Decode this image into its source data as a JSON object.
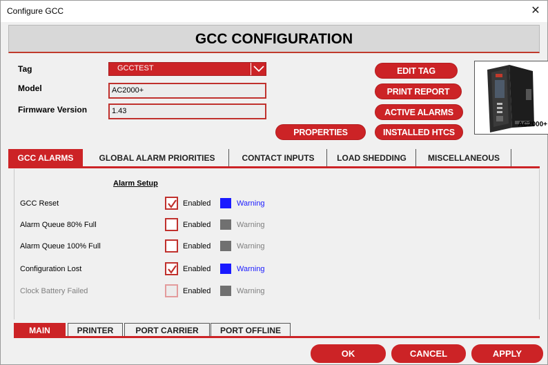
{
  "window": {
    "title": "Configure GCC",
    "close_glyph": "✕"
  },
  "banner": {
    "title": "GCC CONFIGURATION"
  },
  "info": {
    "tag_label": "Tag",
    "tag_value": "GCCTEST",
    "model_label": "Model",
    "model_value": "AC2000+",
    "firmware_label": "Firmware Version",
    "firmware_value": "1.43",
    "device_label": "AC2000+"
  },
  "actions": {
    "edit_tag": "EDIT TAG",
    "print_report": "PRINT REPORT",
    "active_alarms": "ACTIVE ALARMS",
    "installed_htcs": "INSTALLED HTCS",
    "properties": "PROPERTIES"
  },
  "top_tabs": [
    {
      "label": "GCC ALARMS",
      "active": true
    },
    {
      "label": "GLOBAL ALARM PRIORITIES",
      "active": false
    },
    {
      "label": "CONTACT INPUTS",
      "active": false
    },
    {
      "label": "LOAD SHEDDING",
      "active": false
    },
    {
      "label": "MISCELLANEOUS",
      "active": false
    }
  ],
  "alarm_setup": {
    "header": "Alarm Setup",
    "enabled_label": "Enabled",
    "warning_label": "Warning",
    "rows": [
      {
        "name": "GCC Reset",
        "checked": true,
        "disabled": false,
        "severity_color": "#1a1aff"
      },
      {
        "name": "Alarm Queue 80% Full",
        "checked": false,
        "disabled": false,
        "severity_color": "#707070"
      },
      {
        "name": "Alarm Queue 100% Full",
        "checked": false,
        "disabled": false,
        "severity_color": "#707070"
      },
      {
        "name": "Configuration Lost",
        "checked": true,
        "disabled": false,
        "severity_color": "#1a1aff"
      },
      {
        "name": "Clock Battery Failed",
        "checked": false,
        "disabled": true,
        "severity_color": "#707070"
      }
    ]
  },
  "bottom_tabs": [
    {
      "label": "MAIN",
      "active": true
    },
    {
      "label": "PRINTER",
      "active": false
    },
    {
      "label": "PORT CARRIER",
      "active": false
    },
    {
      "label": "PORT OFFLINE",
      "active": false
    }
  ],
  "footer": {
    "ok": "OK",
    "cancel": "CANCEL",
    "apply": "APPLY"
  },
  "colors": {
    "accent": "#cc2326",
    "warning_blue": "#1a1aff",
    "warning_grey": "#707070"
  }
}
